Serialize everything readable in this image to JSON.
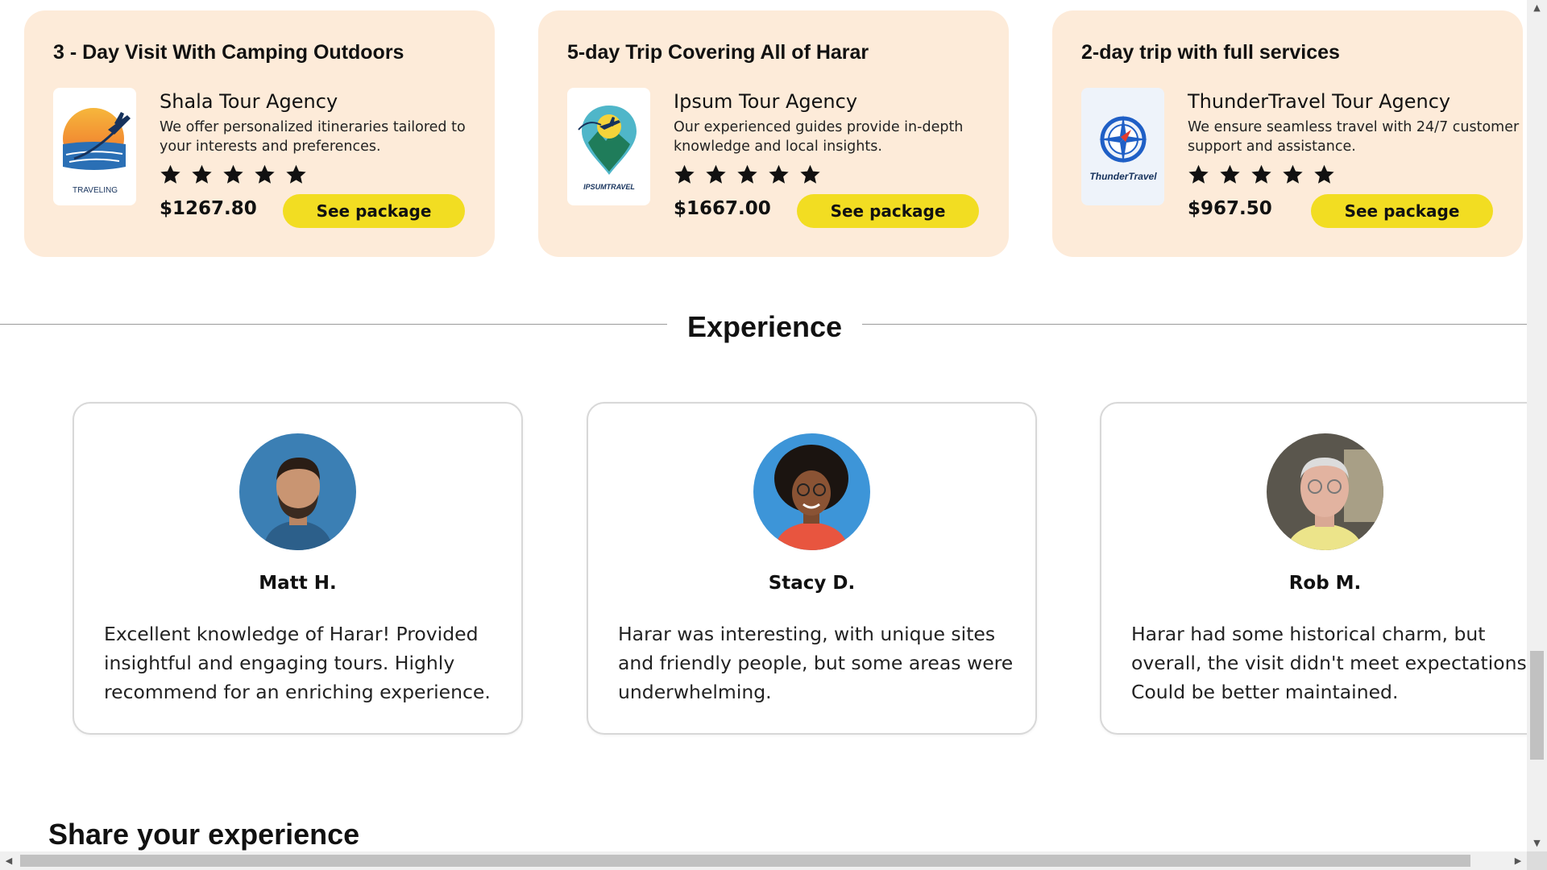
{
  "packages": [
    {
      "title": "3 - Day Visit With Camping Outdoors",
      "agency": "Shala Tour Agency",
      "description": "We offer personalized itineraries tailored to your interests and preferences.",
      "rating": 5,
      "price": "$1267.80",
      "button": "See package",
      "logo_text": "TRAVELING",
      "logo_icon": "airplane-sunset-logo"
    },
    {
      "title": "5-day Trip Covering All of Harar",
      "agency": "Ipsum Tour Agency",
      "description": "Our experienced guides provide in-depth knowledge and local insights.",
      "rating": 5,
      "price": "$1667.00",
      "button": "See package",
      "logo_text": "IPSUMTRAVEL",
      "logo_icon": "map-pin-airplane-logo"
    },
    {
      "title": "2-day trip with full services",
      "agency": "ThunderTravel Tour Agency",
      "description": "We ensure seamless travel with 24/7 customer support and assistance.",
      "rating": 5,
      "price": "$967.50",
      "button": "See package",
      "logo_text": "ThunderTravel",
      "logo_icon": "compass-logo"
    }
  ],
  "experience": {
    "heading": "Experience",
    "testimonials": [
      {
        "name": "Matt H.",
        "text": "Excellent knowledge of Harar! Provided insightful and engaging tours. Highly recommend for an enriching experience."
      },
      {
        "name": "Stacy D.",
        "text": "Harar was interesting, with unique sites and friendly people, but some areas were underwhelming."
      },
      {
        "name": "Rob M.",
        "text": "Harar had some historical charm, but overall, the visit didn't meet expectations. Could be better maintained."
      }
    ]
  },
  "share": {
    "heading": "Share your experience"
  },
  "colors": {
    "card_bg": "#fdebd9",
    "button_bg": "#f2dd22",
    "divider": "#9a9a9a"
  }
}
